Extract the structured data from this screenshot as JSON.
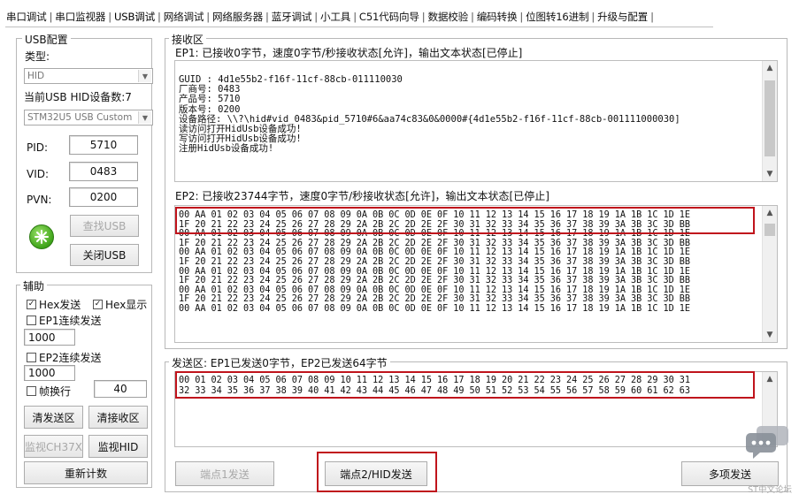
{
  "tabs": [
    {
      "label": "串口调试"
    },
    {
      "label": "串口监视器"
    },
    {
      "label": "USB调试",
      "active": true
    },
    {
      "label": "网络调试"
    },
    {
      "label": "网络服务器"
    },
    {
      "label": "蓝牙调试"
    },
    {
      "label": "小工具"
    },
    {
      "label": "C51代码向导"
    },
    {
      "label": "数据校验"
    },
    {
      "label": "编码转换"
    },
    {
      "label": "位图转16进制"
    },
    {
      "label": "升级与配置"
    }
  ],
  "usb_config": {
    "group_title": "USB配置",
    "type_label": "类型:",
    "type_value": "HID",
    "device_count_label": "当前USB HID设备数:7",
    "device_value": "STM32U5 USB Custom",
    "pid_label": "PID:",
    "pid_value": "5710",
    "vid_label": "VID:",
    "vid_value": "0483",
    "pvn_label": "PVN:",
    "pvn_value": "0200",
    "find_button": "查找USB",
    "close_button": "关闭USB"
  },
  "aux": {
    "group_title": "辅助",
    "hex_send": "Hex发送",
    "hex_send_checked": true,
    "hex_show": "Hex显示",
    "hex_show_checked": true,
    "ep1_continuous": "EP1连续发送",
    "ep1_interval": "1000",
    "ep2_continuous": "EP2连续发送",
    "ep2_interval": "1000",
    "frame_newline": "帧换行",
    "frame_value": "40",
    "clear_send": "清发送区",
    "clear_recv": "清接收区",
    "monitor_ch37x": "监视CH37X",
    "monitor_hid": "监视HID",
    "recount": "重新计数"
  },
  "receive": {
    "group_title": "接收区",
    "ep1_status": "EP1: 已接收0字节，速度0字节/秒接收状态[允许]，输出文本状态[已停止]",
    "ep1_log": [
      "GUID : 4d1e55b2-f16f-11cf-88cb-011110030",
      "厂商号: 0483",
      "产品号: 5710",
      "版本号: 0200",
      "设备路径: \\\\?\\hid#vid_0483&pid_5710#6&aa74c83&0&0000#{4d1e55b2-f16f-11cf-88cb-001111000030]",
      "读访问打开HidUsb设备成功!",
      "写访问打开HidUsb设备成功!",
      "注册HidUsb设备成功!"
    ],
    "ep2_status": "EP2: 已接收23744字节，速度0字节/秒接收状态[允许]，输出文本状态[已停止]",
    "ep2_lines": [
      "00 AA 01 02 03 04 05 06 07 08 09 0A 0B 0C 0D 0E 0F 10 11 12 13 14 15 16 17 18 19 1A 1B 1C 1D 1E",
      "1F 20 21 22 23 24 25 26 27 28 29 2A 2B 2C 2D 2E 2F 30 31 32 33 34 35 36 37 38 39 3A 3B 3C 3D BB",
      "00 AA 01 02 03 04 05 06 07 08 09 0A 0B 0C 0D 0E 0F 10 11 12 13 14 15 16 17 18 19 1A 1B 1C 1D 1E",
      "1F 20 21 22 23 24 25 26 27 28 29 2A 2B 2C 2D 2E 2F 30 31 32 33 34 35 36 37 38 39 3A 3B 3C 3D BB",
      "00 AA 01 02 03 04 05 06 07 08 09 0A 0B 0C 0D 0E 0F 10 11 12 13 14 15 16 17 18 19 1A 1B 1C 1D 1E",
      "1F 20 21 22 23 24 25 26 27 28 29 2A 2B 2C 2D 2E 2F 30 31 32 33 34 35 36 37 38 39 3A 3B 3C 3D BB",
      "00 AA 01 02 03 04 05 06 07 08 09 0A 0B 0C 0D 0E 0F 10 11 12 13 14 15 16 17 18 19 1A 1B 1C 1D 1E",
      "1F 20 21 22 23 24 25 26 27 28 29 2A 2B 2C 2D 2E 2F 30 31 32 33 34 35 36 37 38 39 3A 3B 3C 3D BB",
      "00 AA 01 02 03 04 05 06 07 08 09 0A 0B 0C 0D 0E 0F 10 11 12 13 14 15 16 17 18 19 1A 1B 1C 1D 1E",
      "1F 20 21 22 23 24 25 26 27 28 29 2A 2B 2C 2D 2E 2F 30 31 32 33 34 35 36 37 38 39 3A 3B 3C 3D BB",
      "00 AA 01 02 03 04 05 06 07 08 09 0A 0B 0C 0D 0E 0F 10 11 12 13 14 15 16 17 18 19 1A 1B 1C 1D 1E"
    ]
  },
  "send": {
    "group_title": "发送区: EP1已发送0字节，EP2已发送64字节",
    "lines": [
      "00 01 02 03 04 05 06 07 08 09 10 11 12 13 14 15 16 17 18 19 20 21 22 23 24 25 26 27 28 29 30 31",
      "32 33 34 35 36 37 38 39 40 41 42 43 44 45 46 47 48 49 50 51 52 53 54 55 56 57 58 59 60 61 62 63"
    ],
    "ep1_button": "端点1发送",
    "ep2_button": "端点2/HID发送",
    "multi_button": "多项发送"
  },
  "watermark": {
    "text": "ST中文论坛"
  }
}
